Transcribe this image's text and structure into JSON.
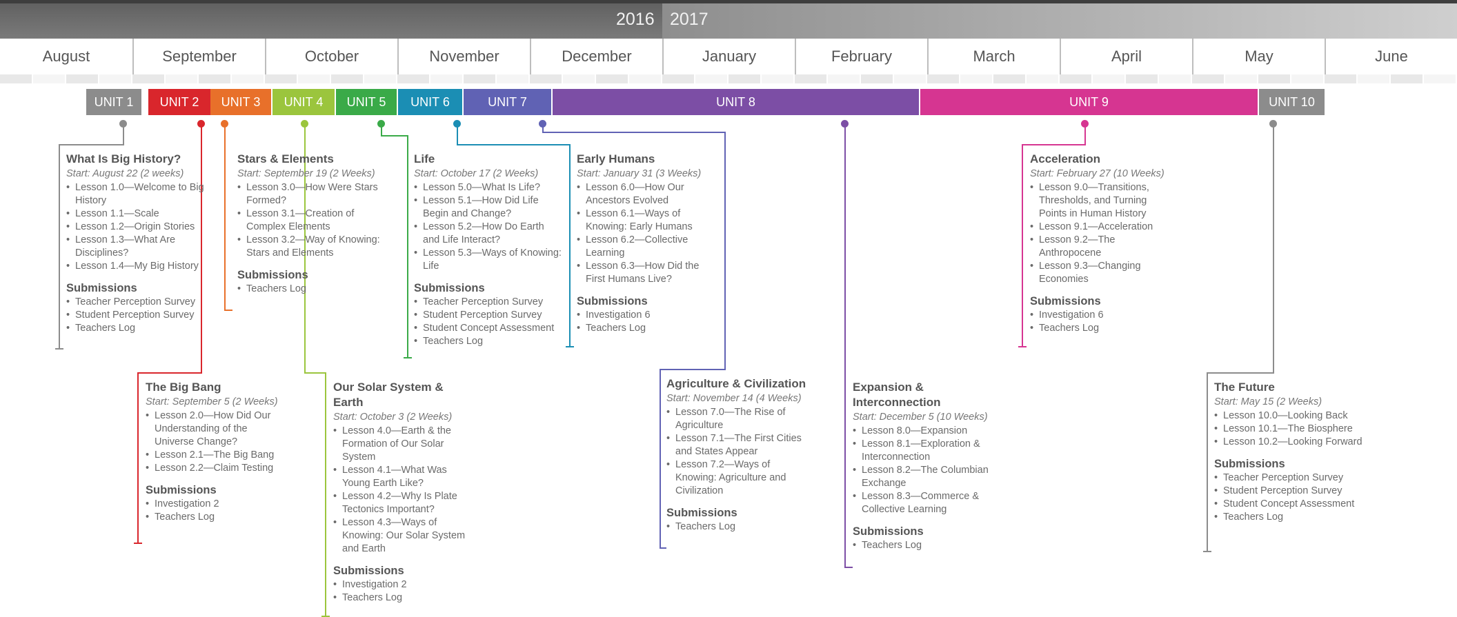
{
  "years": {
    "left": "2016",
    "right": "2017"
  },
  "months": [
    "August",
    "September",
    "October",
    "November",
    "December",
    "January",
    "February",
    "March",
    "April",
    "May",
    "June"
  ],
  "colors": {
    "unit1": "#8c8c8c",
    "unit2": "#d9262c",
    "unit3": "#e8702a",
    "unit4": "#9bc53d",
    "unit5": "#3aaa48",
    "unit6": "#1b8eb4",
    "unit7": "#6062b4",
    "unit8": "#7c4ea5",
    "unit9": "#d63591",
    "unit10": "#8c8c8c"
  },
  "units": [
    {
      "label": "UNIT 1"
    },
    {
      "label": "UNIT 2"
    },
    {
      "label": "UNIT 3"
    },
    {
      "label": "UNIT 4"
    },
    {
      "label": "UNIT 5"
    },
    {
      "label": "UNIT 6"
    },
    {
      "label": "UNIT 7"
    },
    {
      "label": "UNIT 8"
    },
    {
      "label": "UNIT 9"
    },
    {
      "label": "UNIT 10"
    }
  ],
  "cards": [
    {
      "title": "What Is Big History?",
      "start": "Start: August 22 (2 weeks)",
      "lessons": [
        "Lesson 1.0—Welcome to Big History",
        "Lesson 1.1—Scale",
        "Lesson 1.2—Origin Stories",
        "Lesson 1.3—What Are Disciplines?",
        "Lesson 1.4—My Big History"
      ],
      "submissions_label": "Submissions",
      "submissions": [
        "Teacher Perception Survey",
        "Student Perception Survey",
        "Teachers Log"
      ]
    },
    {
      "title": "The Big Bang",
      "start": "Start: September 5 (2 Weeks)",
      "lessons": [
        "Lesson 2.0—How Did Our Understanding of the Universe Change?",
        "Lesson 2.1—The Big Bang",
        "Lesson 2.2—Claim Testing"
      ],
      "submissions_label": "Submissions",
      "submissions": [
        "Investigation 2",
        "Teachers Log"
      ]
    },
    {
      "title": "Stars & Elements",
      "start": "Start: September 19 (2 Weeks)",
      "lessons": [
        "Lesson 3.0—How Were Stars Formed?",
        "Lesson 3.1—Creation of Complex Elements",
        "Lesson 3.2—Way of Knowing: Stars and Elements"
      ],
      "submissions_label": "Submissions",
      "submissions": [
        "Teachers Log"
      ]
    },
    {
      "title": "Our Solar System & Earth",
      "start": "Start: October 3 (2 Weeks)",
      "lessons": [
        "Lesson 4.0—Earth & the Formation of Our Solar System",
        "Lesson 4.1—What Was Young Earth Like?",
        "Lesson 4.2—Why Is Plate Tectonics Important?",
        "Lesson 4.3—Ways of Knowing: Our Solar System and Earth"
      ],
      "submissions_label": "Submissions",
      "submissions": [
        "Investigation 2",
        "Teachers Log"
      ]
    },
    {
      "title": "Life",
      "start": "Start: October 17 (2 Weeks)",
      "lessons": [
        "Lesson 5.0—What Is Life?",
        "Lesson 5.1—How Did Life Begin and Change?",
        "Lesson 5.2—How Do Earth and Life Interact?",
        "Lesson 5.3—Ways of Knowing: Life"
      ],
      "submissions_label": "Submissions",
      "submissions": [
        "Teacher Perception Survey",
        "Student Perception Survey",
        "Student Concept Assessment",
        "Teachers Log"
      ]
    },
    {
      "title": "Early Humans",
      "start": "Start: January 31 (3 Weeks)",
      "lessons": [
        "Lesson 6.0—How Our Ancestors Evolved",
        "Lesson 6.1—Ways of Knowing: Early Humans",
        "Lesson 6.2—Collective Learning",
        "Lesson 6.3—How Did the First Humans Live?"
      ],
      "submissions_label": "Submissions",
      "submissions": [
        "Investigation 6",
        "Teachers Log"
      ]
    },
    {
      "title": "Agriculture & Civilization",
      "start": "Start: November 14 (4 Weeks)",
      "lessons": [
        "Lesson 7.0—The Rise of Agriculture",
        "Lesson 7.1—The First Cities and States Appear",
        "Lesson 7.2—Ways of Knowing: Agriculture and Civilization"
      ],
      "submissions_label": "Submissions",
      "submissions": [
        "Teachers Log"
      ]
    },
    {
      "title": "Expansion & Interconnection",
      "start": "Start: December 5 (10 Weeks)",
      "lessons": [
        "Lesson 8.0—Expansion",
        "Lesson 8.1—Exploration & Interconnection",
        "Lesson 8.2—The Columbian Exchange",
        "Lesson 8.3—Commerce & Collective Learning"
      ],
      "submissions_label": "Submissions",
      "submissions": [
        "Teachers Log"
      ]
    },
    {
      "title": "Acceleration",
      "start": "Start: February 27 (10 Weeks)",
      "lessons": [
        "Lesson 9.0—Transitions, Thresholds, and Turning Points in Human History",
        "Lesson 9.1—Acceleration",
        "Lesson 9.2—The Anthropocene",
        "Lesson 9.3—Changing Economies"
      ],
      "submissions_label": "Submissions",
      "submissions": [
        "Investigation 6",
        "Teachers Log"
      ]
    },
    {
      "title": "The Future",
      "start": "Start: May 15 (2 Weeks)",
      "lessons": [
        "Lesson 10.0—Looking Back",
        "Lesson 10.1—The Biosphere",
        "Lesson 10.2—Looking Forward"
      ],
      "submissions_label": "Submissions",
      "submissions": [
        "Teacher Perception Survey",
        "Student Perception Survey",
        "Student Concept Assessment",
        "Teachers Log"
      ]
    }
  ]
}
